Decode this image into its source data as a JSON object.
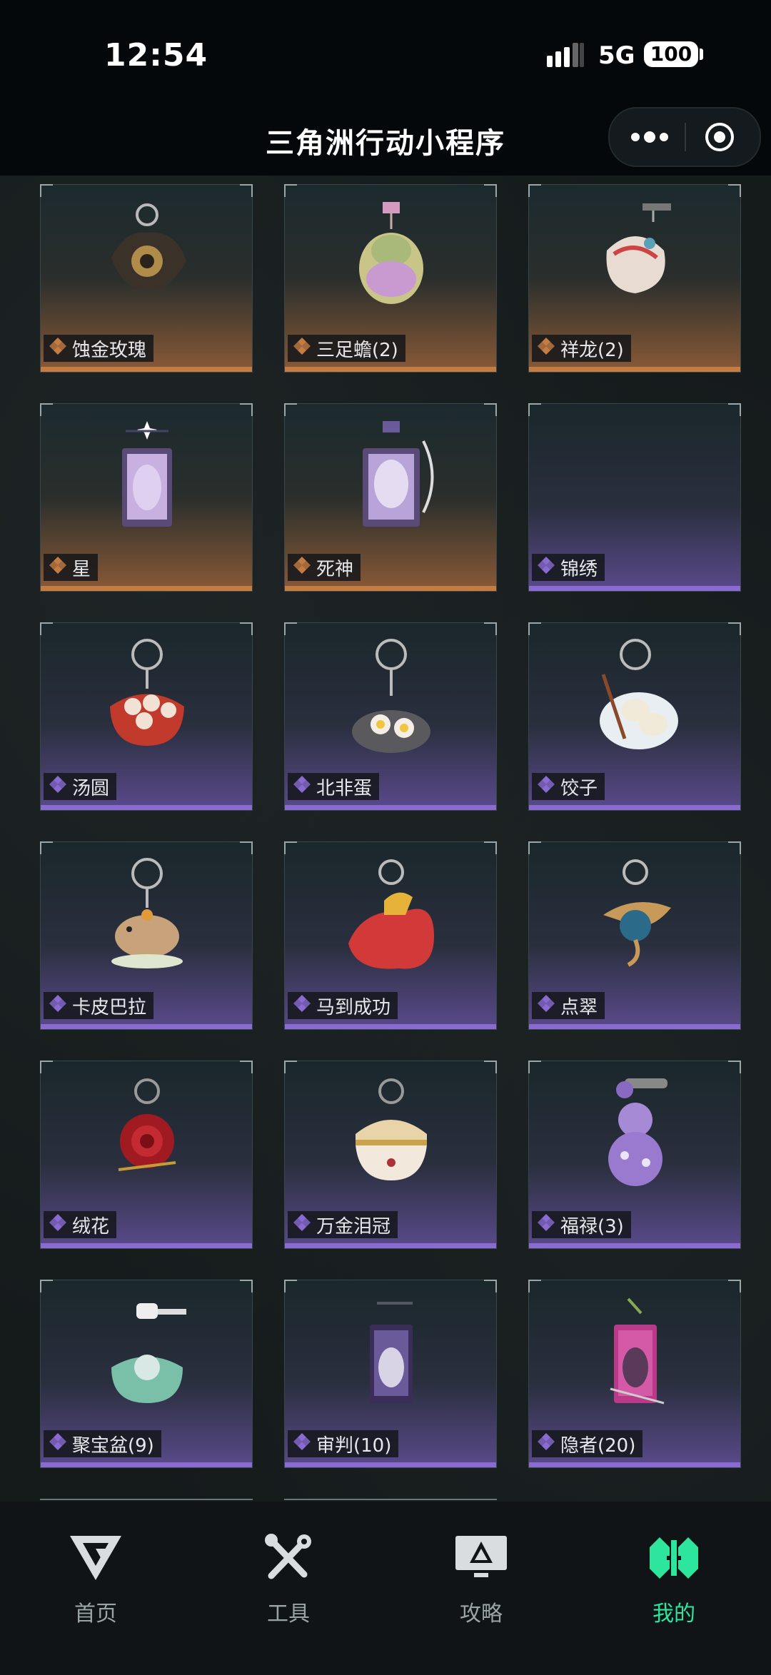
{
  "status": {
    "time": "12:54",
    "network": "5G",
    "battery": "100"
  },
  "nav": {
    "title": "三角洲行动小程序"
  },
  "items": [
    {
      "name": "蚀金玫瑰",
      "rarity": "gold",
      "art": "dark-rose-keychain"
    },
    {
      "name": "三足蟾(2)",
      "rarity": "gold",
      "art": "toad-keychain"
    },
    {
      "name": "祥龙(2)",
      "rarity": "gold",
      "art": "dragon-keychain"
    },
    {
      "name": "星",
      "rarity": "gold",
      "art": "star-card-keychain"
    },
    {
      "name": "死神",
      "rarity": "gold",
      "art": "reaper-card-keychain"
    },
    {
      "name": "锦绣",
      "rarity": "purple",
      "art": ""
    },
    {
      "name": "汤圆",
      "rarity": "purple",
      "art": "tangyuan-bowl-keychain"
    },
    {
      "name": "北非蛋",
      "rarity": "purple",
      "art": "shakshuka-pan-keychain"
    },
    {
      "name": "饺子",
      "rarity": "purple",
      "art": "dumpling-plate-keychain"
    },
    {
      "name": "卡皮巴拉",
      "rarity": "purple",
      "art": "capybara-keychain"
    },
    {
      "name": "马到成功",
      "rarity": "purple",
      "art": "red-horse-keychain"
    },
    {
      "name": "点翠",
      "rarity": "purple",
      "art": "kingfisher-keychain"
    },
    {
      "name": "绒花",
      "rarity": "purple",
      "art": "red-flower-keychain"
    },
    {
      "name": "万金泪冠",
      "rarity": "purple",
      "art": "jewel-egg-keychain"
    },
    {
      "name": "福禄(3)",
      "rarity": "purple",
      "art": "gourd-keychain"
    },
    {
      "name": "聚宝盆(9)",
      "rarity": "purple",
      "art": "treasure-bowl-keychain"
    },
    {
      "name": "审判(10)",
      "rarity": "purple",
      "art": "judgement-card-keychain"
    },
    {
      "name": "隐者(20)",
      "rarity": "purple",
      "art": "hermit-card-keychain"
    }
  ],
  "colors": {
    "gold": "#c57c43",
    "purple": "#8a6bd2",
    "active_tab": "#2ee59d"
  },
  "tabs": [
    {
      "label": "首页",
      "icon": "home-logo-icon",
      "active": false
    },
    {
      "label": "工具",
      "icon": "tools-icon",
      "active": false
    },
    {
      "label": "攻略",
      "icon": "guide-monitor-icon",
      "active": false
    },
    {
      "label": "我的",
      "icon": "mine-logo-icon",
      "active": true
    }
  ]
}
